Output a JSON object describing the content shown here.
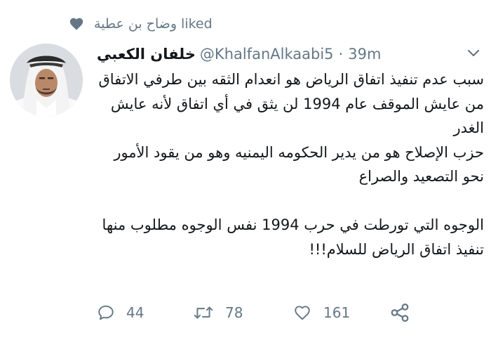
{
  "social_context": {
    "liker": "وضاح بن عطية",
    "action": "liked",
    "icon": "heart-icon"
  },
  "tweet": {
    "author_name": "خلفان الكعبي",
    "handle": "@KhalfanAlkaabi5",
    "separator": "·",
    "time": "39m",
    "paragraphs": [
      "سبب عدم تنفيذ اتفاق الرياض هو انعدام الثقه بين طرفي الاتفاق",
      "من عايش الموقف عام 1994 لن يثق في أي اتفاق لأنه عايش الغدر",
      "حزب الإصلاح هو من يدير الحكومه اليمنيه وهو من يقود الأمور نحو التصعيد والصراع",
      "الوجوه التي تورطت في حرب 1994 نفس الوجوه مطلوب منها تنفيذ اتفاق الرياض للسلام!!!"
    ]
  },
  "actions": {
    "reply": {
      "icon": "reply-icon",
      "count": "44"
    },
    "retweet": {
      "icon": "retweet-icon",
      "count": "78"
    },
    "like": {
      "icon": "heart-outline-icon",
      "count": "161"
    },
    "share": {
      "icon": "share-icon"
    }
  },
  "colors": {
    "muted": "#657786",
    "text": "#14171a"
  }
}
